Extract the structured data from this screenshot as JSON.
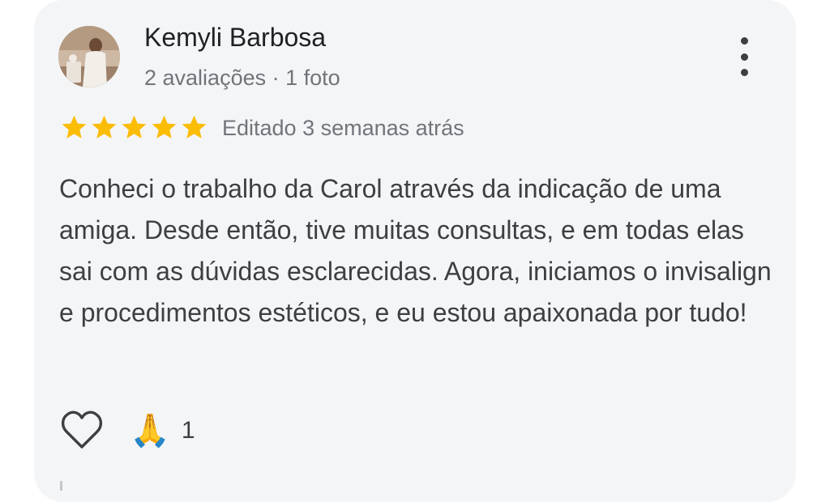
{
  "review": {
    "author_name": "Kemyli Barbosa",
    "author_meta": "2 avaliações · 1 foto",
    "rating": 5,
    "rating_max": 5,
    "edited_label": "Editado 3 semanas atrás",
    "text": "Conheci o trabalho da Carol através da indicação de uma amiga. Desde então, tive muitas consultas, e em todas elas sai com as dúvidas esclarecidas. Agora, iniciamos o invisalign e procedimentos estéticos, e eu estou apaixonada por tudo!",
    "reaction_emoji": "🙏",
    "reaction_count": "1"
  },
  "icons": {
    "avatar": "avatar",
    "more": "more-vert-icon",
    "star": "star-icon",
    "like": "heart-outline-icon"
  },
  "colors": {
    "card_bg": "#f4f5f7",
    "star": "#fbbc04",
    "text_primary": "#202124",
    "text_secondary": "#70757a",
    "text_body": "#3c4043"
  }
}
